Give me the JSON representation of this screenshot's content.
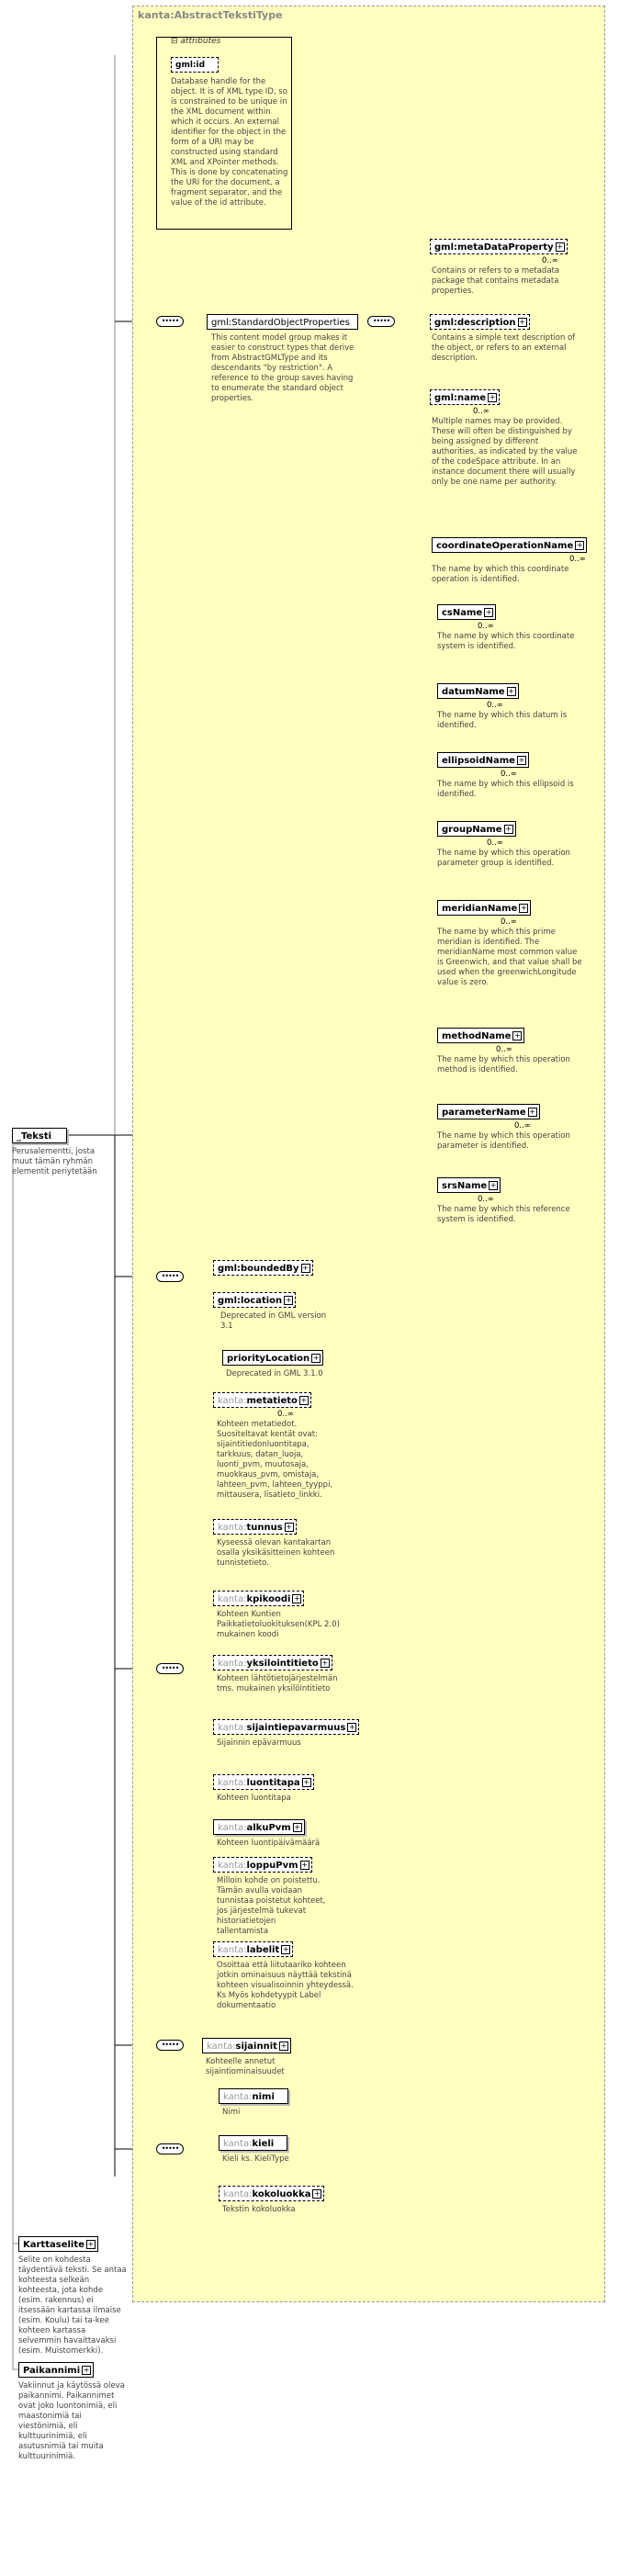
{
  "diagram": {
    "type_name": "kanta:AbstractTekstiType",
    "attributes_label": "attributes",
    "root": {
      "name": "_Teksti",
      "desc": "Perusalementti, josta muut tämän ryhmän elementit periytetään"
    },
    "gml_id": {
      "name": "gml:id",
      "desc": "Database handle for the object.  It is of XML type ID, so is constrained to be unique in the XML document within which it occurs.  An external identifier for the object in the form of a URI may be constructed using standard XML and XPointer methods.  This is done by concatenating the URI for the document, a fragment separator, and the value of the id attribute."
    },
    "std_props": {
      "name": "gml:StandardObjectProperties",
      "desc": "This content model group makes it easier to construct types that derive from AbstractGMLType and its descendants \"by restriction\". A reference to the group saves having to enumerate the standard object properties."
    },
    "std_items": [
      {
        "name": "gml:metaDataProperty",
        "card": "0..∞",
        "desc": "Contains or refers to a metadata package that contains metadata properties."
      },
      {
        "name": "gml:description",
        "card": "",
        "desc": "Contains a simple text description of the object, or refers to an external description."
      },
      {
        "name": "gml:name",
        "card": "0..∞",
        "desc": "Multiple names may be provided.  These will often be distinguished by being assigned by different authorities, as indicated by the value of the codeSpace attribute.  In an instance document there will usually only be one name per authority."
      },
      {
        "name": "coordinateOperationName",
        "card": "0..∞",
        "desc": "The name by which this coordinate operation is identified."
      },
      {
        "name": "csName",
        "card": "0..∞",
        "desc": "The name by which this coordinate system is identified."
      },
      {
        "name": "datumName",
        "card": "0..∞",
        "desc": "The name by which this datum is identified."
      },
      {
        "name": "ellipsoidName",
        "card": "0..∞",
        "desc": "The name by which this ellipsoid is identified."
      },
      {
        "name": "groupName",
        "card": "0..∞",
        "desc": "The name by which this operation parameter group is identified."
      },
      {
        "name": "meridianName",
        "card": "0..∞",
        "desc": "The name by which this prime meridian is identified. The meridianName most common value is Greenwich, and that value shall be used when the greenwichLongitude value is zero."
      },
      {
        "name": "methodName",
        "card": "0..∞",
        "desc": "The name by which this operation method is identified."
      },
      {
        "name": "parameterName",
        "card": "0..∞",
        "desc": "The name by which this operation parameter is identified."
      },
      {
        "name": "srsName",
        "card": "0..∞",
        "desc": "The name by which this reference system is identified."
      }
    ],
    "bounded_by": {
      "name": "gml:boundedBy"
    },
    "location": {
      "name": "gml:location",
      "desc": "Deprecated in GML version 3.1"
    },
    "priority_location": {
      "name": "priorityLocation",
      "desc": "Deprecated in GML 3.1.0"
    },
    "kanta_prefix": "kanta:",
    "kanta_items": [
      {
        "name": "metatieto",
        "card": "0..∞",
        "desc": "Kohteen metatiedot. Suositeltavat kentät ovat: sijaintitiedonluontitapa, tarkkuus, datan_luoja, luonti_pvm, muutosaja, muokkaus_pvm, omistaja, lahteen_pvm, lahteen_tyyppi, mittausera, lisatieto_linkki."
      },
      {
        "name": "tunnus",
        "card": "",
        "desc": "Kyseessä olevan kantakartan osalla yksikäsitteinen kohteen tunnistetieto."
      },
      {
        "name": "kpikoodi",
        "card": "",
        "desc": "Kohteen Kuntien Paikkatietoluokituksen(KPL 2.0) mukainen koodi"
      },
      {
        "name": "yksilointitieto",
        "card": "",
        "desc": "Kohteen lähtötietojärjestelmän  tms. mukainen yksilöintitieto"
      },
      {
        "name": "sijaintiepavarmuus",
        "card": "",
        "desc": "Sijainnin epävarmuus"
      },
      {
        "name": "luontitapa",
        "card": "",
        "desc": "Kohteen luontitapa"
      },
      {
        "name": "alkuPvm",
        "card": "",
        "desc": "Kohteen luontipäivämäärä"
      },
      {
        "name": "loppuPvm",
        "card": "",
        "desc": "Milloin kohde on poistettu. Tämän avulla voidaan tunnistaa poistetut kohteet, jos järjestelmä tukevat historiatietojen tallentamista"
      },
      {
        "name": "labelit",
        "card": "",
        "desc": "Osoittaa että liitutaariko kohteen jotkin ominaisuus näyttää tekstinä kohteen visualisoinnin yhteydessä.  Ks Myös kohdetyypit Label dokumentaatio"
      }
    ],
    "sijainnit": {
      "name": "sijainnit",
      "desc": "Kohteelle annetut sijaintiominaisuudet"
    },
    "text_items": [
      {
        "name": "nimi",
        "desc": "Nimi"
      },
      {
        "name": "kieli",
        "desc": "Kieli ks. KieliType"
      },
      {
        "name": "kokoluokka",
        "desc": "Tekstin kokoluokka"
      }
    ],
    "karttaselite": {
      "name": "Karttaselite",
      "desc": "Selite on kohdesta täydentävä teksti. Se antaa kohteesta selkeän kohteesta, jota kohde (esim. rakennus) ei itsessään kartassa ilmaise (esim. Koulu) tai ta-kee kohteen kartassa selvemmin havaittavaksi (esim. Muistomerkki)."
    },
    "paikannimi": {
      "name": "Paikannimi",
      "desc": "Vakiinnut ja käytössä oleva paikannimi. Paikannimet ovat joko luontonimiä, eli maastonimiä tai viestönimiä, eli kulttuurinimiä, eli asutusnimiä tai muita kulttuurinimiä."
    },
    "compositor_glyph": "•••••"
  }
}
